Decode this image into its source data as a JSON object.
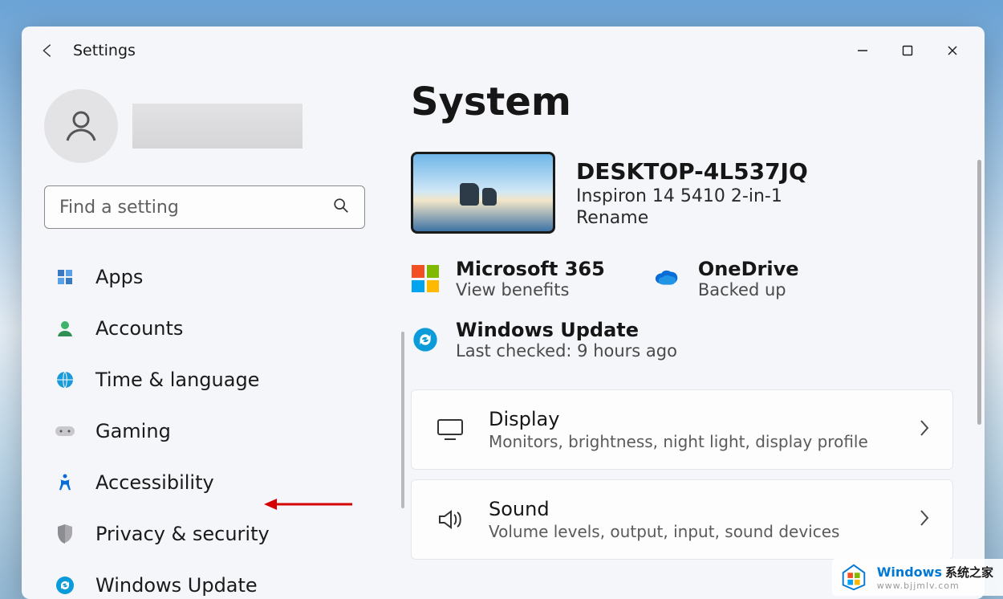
{
  "wallpaper": {
    "desc": "sky-clouds"
  },
  "window": {
    "title": "Settings"
  },
  "search": {
    "placeholder": "Find a setting"
  },
  "sidebar": {
    "items": [
      {
        "label": "Apps",
        "icon": "apps-icon"
      },
      {
        "label": "Accounts",
        "icon": "account-icon"
      },
      {
        "label": "Time & language",
        "icon": "globe-clock-icon"
      },
      {
        "label": "Gaming",
        "icon": "gamepad-icon"
      },
      {
        "label": "Accessibility",
        "icon": "accessibility-icon"
      },
      {
        "label": "Privacy & security",
        "icon": "shield-icon"
      },
      {
        "label": "Windows Update",
        "icon": "update-icon"
      }
    ]
  },
  "main": {
    "page_title": "System",
    "device": {
      "name": "DESKTOP-4L537JQ",
      "model": "Inspiron 14 5410 2-in-1",
      "rename_label": "Rename"
    },
    "status": {
      "m365": {
        "title": "Microsoft 365",
        "sub": "View benefits"
      },
      "onedrive": {
        "title": "OneDrive",
        "sub": "Backed up"
      },
      "update": {
        "title": "Windows Update",
        "sub": "Last checked: 9 hours ago"
      }
    },
    "cards": [
      {
        "title": "Display",
        "sub": "Monitors, brightness, night light, display profile"
      },
      {
        "title": "Sound",
        "sub": "Volume levels, output, input, sound devices"
      }
    ]
  },
  "annotation": {
    "arrow_color": "#d40000"
  },
  "watermark": {
    "brand": "Windows",
    "cn": "系统之家",
    "url": "www.bjjmlv.com"
  }
}
